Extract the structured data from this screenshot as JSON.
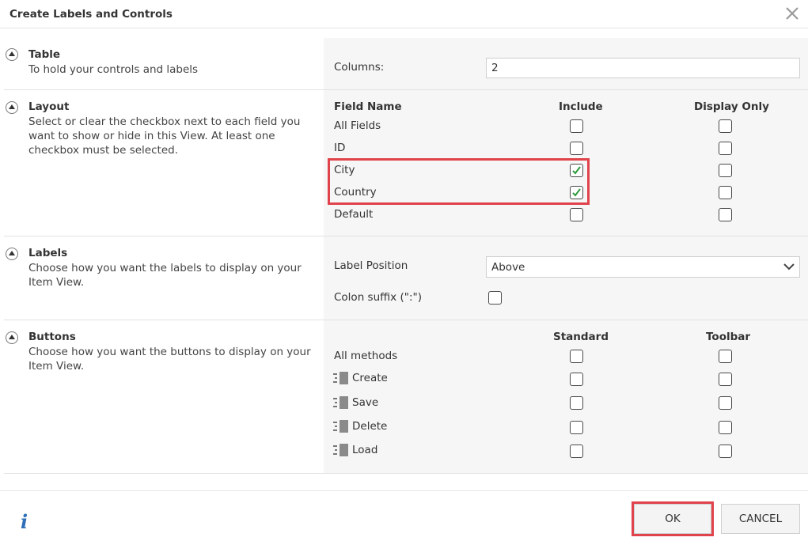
{
  "dialog": {
    "title": "Create Labels and Controls"
  },
  "sections": {
    "table": {
      "title": "Table",
      "description": "To hold your controls and labels",
      "columns_label": "Columns:",
      "columns_value": "2"
    },
    "layout": {
      "title": "Layout",
      "description": "Select or clear the checkbox next to each field you want to show or hide in this View. At least one checkbox must be selected.",
      "headers": {
        "field_name": "Field Name",
        "include": "Include",
        "display_only": "Display Only"
      },
      "rows": [
        {
          "name": "All Fields",
          "include": false,
          "display_only": false
        },
        {
          "name": "ID",
          "include": false,
          "display_only": false
        },
        {
          "name": "City",
          "include": true,
          "display_only": false
        },
        {
          "name": "Country",
          "include": true,
          "display_only": false
        },
        {
          "name": "Default",
          "include": false,
          "display_only": false
        }
      ]
    },
    "labels": {
      "title": "Labels",
      "description": "Choose how you want the labels to display on your Item View.",
      "label_position_label": "Label Position",
      "label_position_value": "Above",
      "colon_suffix_label": "Colon suffix (\":\")",
      "colon_suffix_checked": false
    },
    "buttons": {
      "title": "Buttons",
      "description": "Choose how you want the buttons to display on your Item View.",
      "headers": {
        "standard": "Standard",
        "toolbar": "Toolbar"
      },
      "rows": [
        {
          "name": "All methods",
          "icon": ""
        },
        {
          "name": "Create",
          "icon": "method-icon"
        },
        {
          "name": "Save",
          "icon": "method-icon"
        },
        {
          "name": "Delete",
          "icon": "method-icon"
        },
        {
          "name": "Load",
          "icon": "method-icon"
        }
      ]
    }
  },
  "footer": {
    "info_icon": "i",
    "ok_label": "OK",
    "cancel_label": "CANCEL"
  },
  "colors": {
    "highlight": "#e0434b",
    "check": "#2e9a3a",
    "info": "#2e6fb7"
  }
}
